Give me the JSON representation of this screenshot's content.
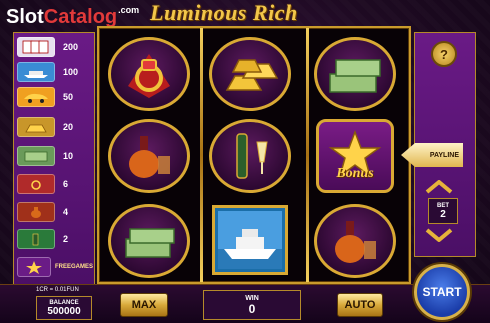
{
  "header": {
    "logo_slot": "Slot",
    "logo_catalog": "Catalog",
    "logo_com": ".com",
    "game_title": "Luminous Rich"
  },
  "paytable": [
    {
      "symbol": "cards-icon",
      "value": "200"
    },
    {
      "symbol": "yacht-icon",
      "value": "100"
    },
    {
      "symbol": "car-icon",
      "value": "50"
    },
    {
      "symbol": "gold-icon",
      "value": "20"
    },
    {
      "symbol": "cash-icon",
      "value": "10"
    },
    {
      "symbol": "ring-icon",
      "value": "6"
    },
    {
      "symbol": "cognac-icon",
      "value": "4"
    },
    {
      "symbol": "champagne-icon",
      "value": "2"
    },
    {
      "symbol": "bonus-icon",
      "value": "FREEGAMES"
    }
  ],
  "reels": {
    "bonus_label": "Bonus"
  },
  "controls": {
    "help_label": "?",
    "payline_label": "PAYLINE",
    "bet_label": "BET",
    "bet_value": "2",
    "credit_rate": "1CR = 0.01FUN",
    "balance_label": "BALANCE",
    "balance_value": "500000",
    "max_label": "MAX",
    "win_label": "WIN",
    "win_value": "0",
    "auto_label": "AUTO",
    "start_label": "START"
  },
  "colors": {
    "gold": "#d9a934",
    "purple": "#5a1470",
    "start_blue": "#2a56c8"
  }
}
